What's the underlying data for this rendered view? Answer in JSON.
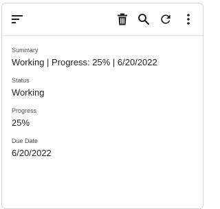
{
  "toolbar": {
    "icons": [
      "sort-icon",
      "delete-icon",
      "search-icon",
      "refresh-icon",
      "more-vert-icon"
    ],
    "icon_color": "#202124"
  },
  "fields": {
    "summary": {
      "label": "Summary",
      "value": "Working | Progress: 25% | 6/20/2022"
    },
    "status": {
      "label": "Status",
      "value": "Working"
    },
    "progress": {
      "label": "Progress",
      "value": "25%"
    },
    "due_date": {
      "label": "Due Date",
      "value": "6/20/2022"
    }
  }
}
